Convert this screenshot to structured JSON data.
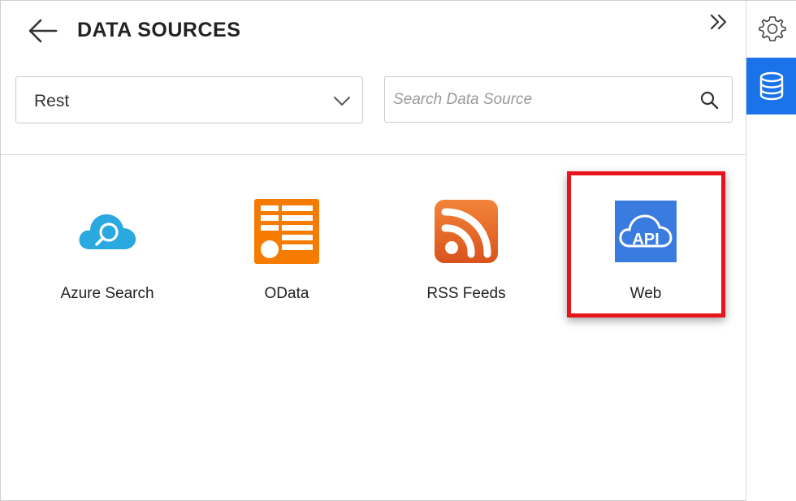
{
  "header": {
    "title": "DATA SOURCES",
    "back_icon": "arrow-left-icon",
    "collapse_icon": "double-chevron-right-icon"
  },
  "filter": {
    "selected_type": "Rest",
    "search_placeholder": "Search Data Source",
    "search_value": ""
  },
  "data_sources": [
    {
      "label": "Azure Search",
      "icon": "cloud-search-icon",
      "color": "#2aa8e0"
    },
    {
      "label": "OData",
      "icon": "odata-icon",
      "color": "#f57c00"
    },
    {
      "label": "RSS Feeds",
      "icon": "rss-icon",
      "color": "#e8641c"
    },
    {
      "label": "Web",
      "icon": "api-cloud-icon",
      "color": "#3a7be0",
      "highlighted": true
    }
  ],
  "rail": {
    "items": [
      {
        "icon": "gear-icon",
        "active": false
      },
      {
        "icon": "database-icon",
        "active": true
      }
    ],
    "accent": "#1a73e8"
  },
  "highlight_color": "#e8141c"
}
